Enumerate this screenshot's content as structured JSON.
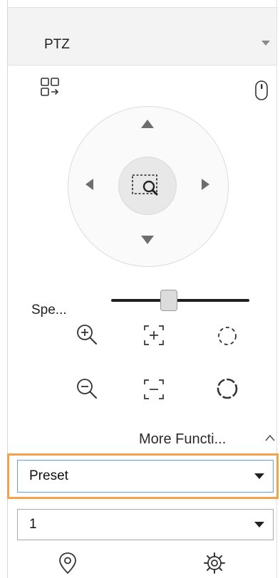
{
  "panel": {
    "title": "PTZ",
    "speed_label": "Spe...",
    "speed_value_fraction": 0.42,
    "more_functions_label": "More Functi...",
    "preset_select": {
      "selected": "Preset"
    },
    "number_select": {
      "selected": "1"
    }
  },
  "icons": {
    "layout": "layout-switch-icon",
    "mouse": "mouse-icon",
    "zoom_region": "zoom-region-icon",
    "zoom_in": "zoom-in-icon",
    "zoom_out": "zoom-out-icon",
    "focus_near": "focus-plus-icon",
    "focus_far": "focus-minus-icon",
    "iris_small": "iris-open-icon",
    "iris_large": "iris-close-icon",
    "location": "location-pin-icon",
    "settings": "gear-icon"
  },
  "colors": {
    "highlight": "#f6a24a",
    "active_border": "#5f9ee8"
  }
}
